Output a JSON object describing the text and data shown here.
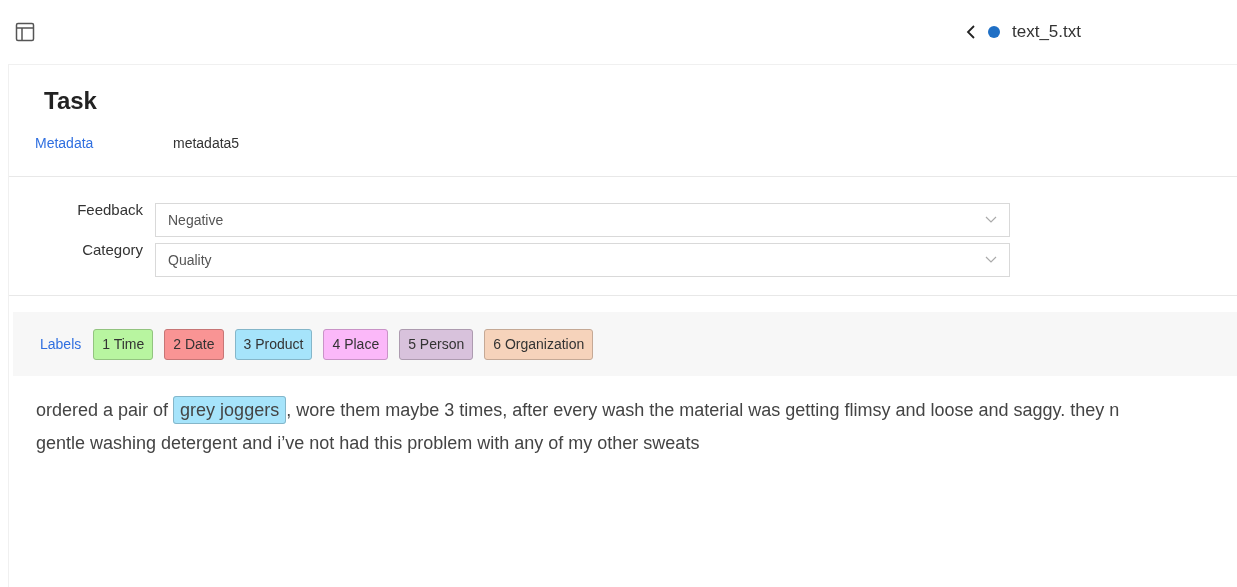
{
  "header": {
    "file": {
      "name": "text_5.txt",
      "color": "#1f6fc5"
    }
  },
  "task": {
    "title": "Task",
    "metadata": {
      "label": "Metadata",
      "value": "metadata5"
    }
  },
  "fields": [
    {
      "label": "Feedback",
      "value": "Negative"
    },
    {
      "label": "Category",
      "value": "Quality"
    }
  ],
  "labels": {
    "title": "Labels",
    "items": [
      {
        "text": "1 Time",
        "color": "#b8f5a0"
      },
      {
        "text": "2 Date",
        "color": "#f99494"
      },
      {
        "text": "3 Product",
        "color": "#a6e4fb"
      },
      {
        "text": "4 Place",
        "color": "#fbb8f9"
      },
      {
        "text": "5 Person",
        "color": "#d8c2dc"
      },
      {
        "text": "6 Organization",
        "color": "#f6d3bb"
      }
    ]
  },
  "text": {
    "lines": [
      [
        {
          "kind": "plain",
          "text": "ordered a pair of "
        },
        {
          "kind": "entity",
          "text": "grey joggers",
          "color": "#a6e4fb"
        },
        {
          "kind": "plain",
          "text": ", wore them maybe 3 times, after every wash the material was getting flimsy and loose and saggy. they n"
        }
      ],
      [
        {
          "kind": "plain",
          "text": "gentle washing detergent and i’ve not had this problem with any of my other sweats"
        }
      ]
    ]
  }
}
